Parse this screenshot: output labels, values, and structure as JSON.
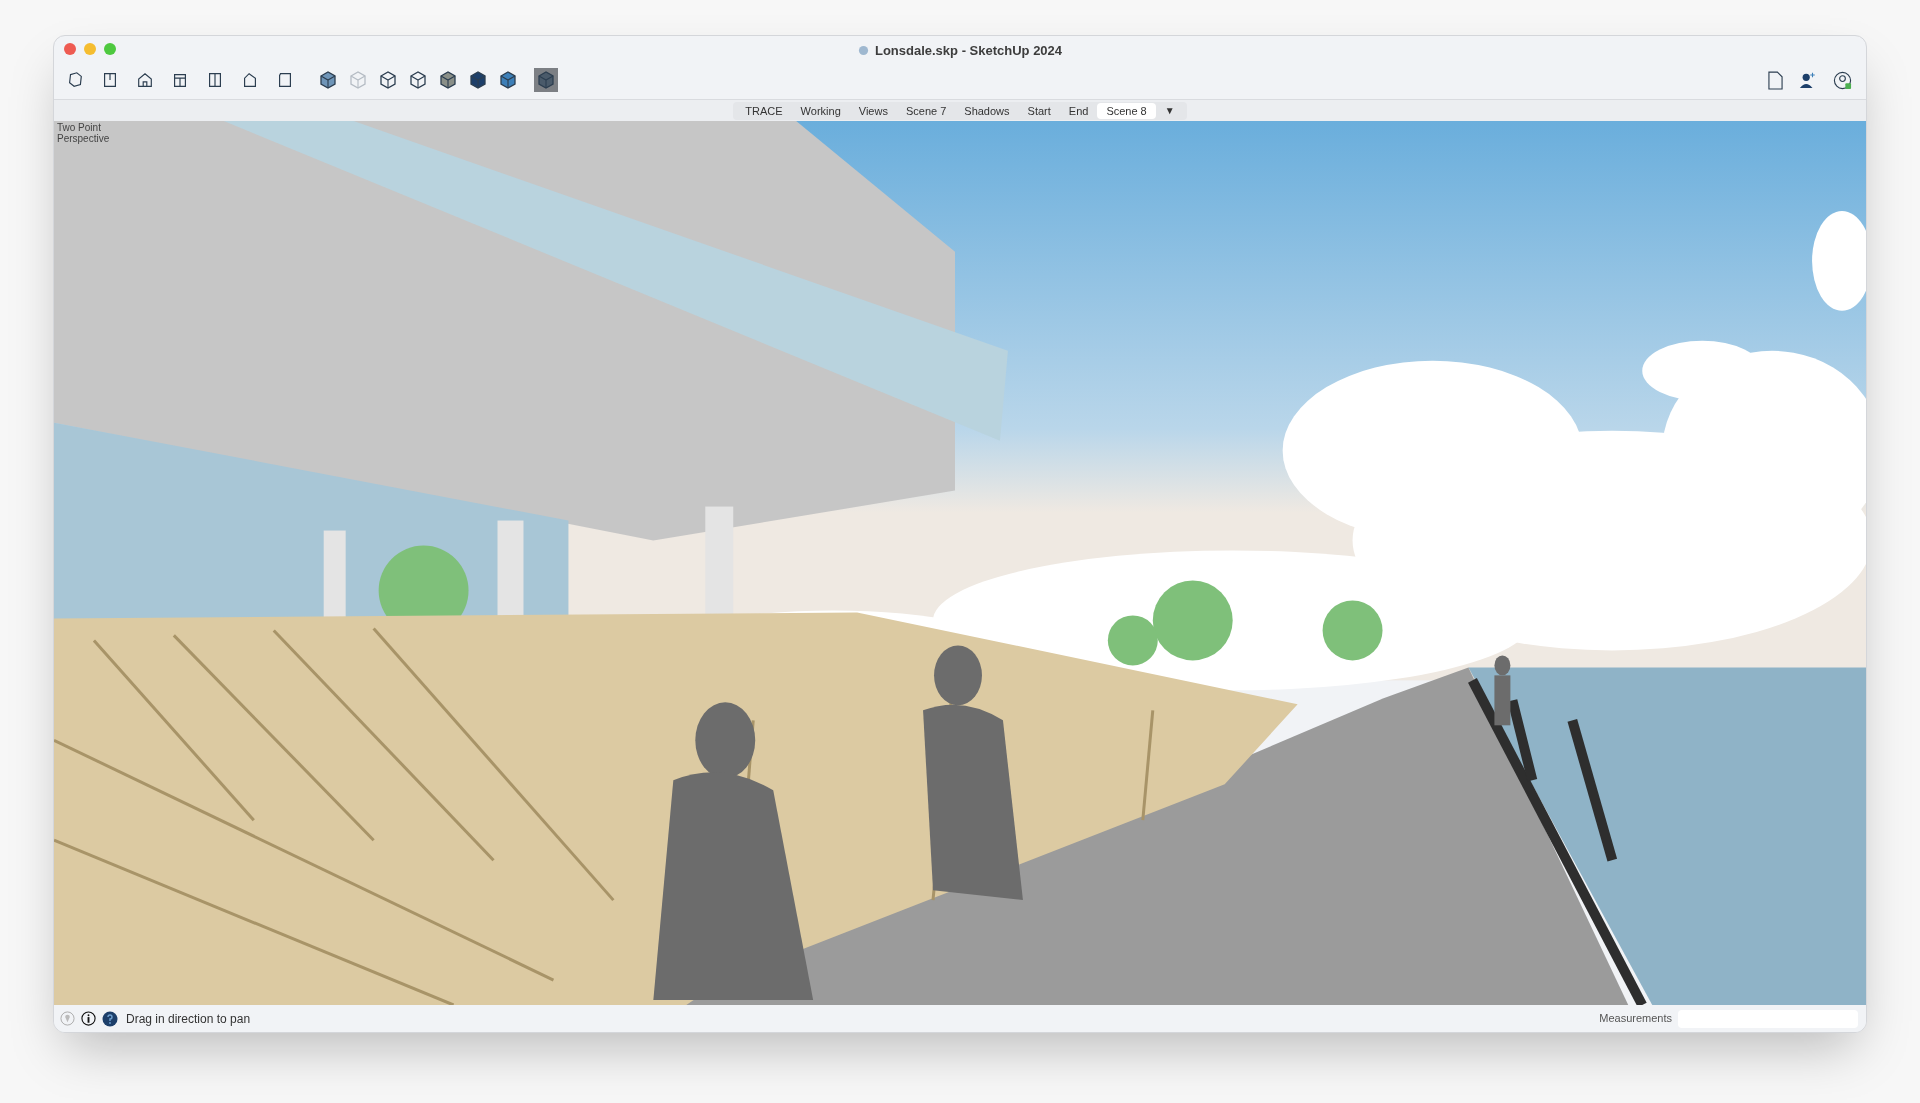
{
  "window": {
    "title": "Lonsdale.skp - SketchUp 2024"
  },
  "view_tools": [
    {
      "selected": false
    },
    {
      "selected": false
    },
    {
      "selected": false
    },
    {
      "selected": false
    },
    {
      "selected": false
    },
    {
      "selected": false
    },
    {
      "selected": false
    }
  ],
  "style_tools": [
    {
      "selected": false
    },
    {
      "selected": false
    },
    {
      "selected": false
    },
    {
      "selected": false
    },
    {
      "selected": false
    },
    {
      "selected": false
    },
    {
      "selected": false
    },
    {
      "selected": true
    }
  ],
  "scene_tabs": [
    {
      "label": "TRACE",
      "selected": false
    },
    {
      "label": "Working",
      "selected": false
    },
    {
      "label": "Views",
      "selected": false
    },
    {
      "label": "Scene 7",
      "selected": false
    },
    {
      "label": "Shadows",
      "selected": false
    },
    {
      "label": "Start",
      "selected": false
    },
    {
      "label": "End",
      "selected": false
    },
    {
      "label": "Scene 8",
      "selected": true
    }
  ],
  "scene_menu": "▼",
  "viewport": {
    "camera_label": "Two Point Perspective"
  },
  "status_bar": {
    "hint": "Drag in direction to pan",
    "measurements_label": "Measurements"
  }
}
